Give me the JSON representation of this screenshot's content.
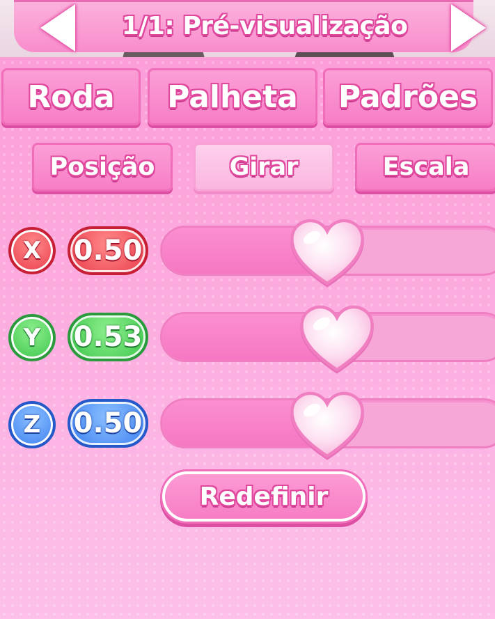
{
  "header": {
    "title": "1/1: Pré-visualização",
    "prev_icon": "triangle-left-icon",
    "next_icon": "triangle-right-icon"
  },
  "tabs": [
    {
      "label": "Roda",
      "active": false
    },
    {
      "label": "Palheta",
      "active": false
    },
    {
      "label": "Padrões",
      "active": false
    }
  ],
  "subtabs": [
    {
      "label": "Posição",
      "active": false
    },
    {
      "label": "Girar",
      "active": true
    },
    {
      "label": "Escala",
      "active": false
    }
  ],
  "sliders": [
    {
      "axis_label": "X",
      "value": "0.50",
      "level": 0.5,
      "color": "#e93b49"
    },
    {
      "axis_label": "Y",
      "value": "0.53",
      "level": 0.53,
      "color": "#3bc44a"
    },
    {
      "axis_label": "Z",
      "value": "0.50",
      "level": 0.5,
      "color": "#3b7ff0"
    }
  ],
  "reset_button": {
    "label": "Redefinir"
  },
  "colors": {
    "background": "#fcaade",
    "accent": "#f77ec6",
    "outline": "#e0489e"
  }
}
